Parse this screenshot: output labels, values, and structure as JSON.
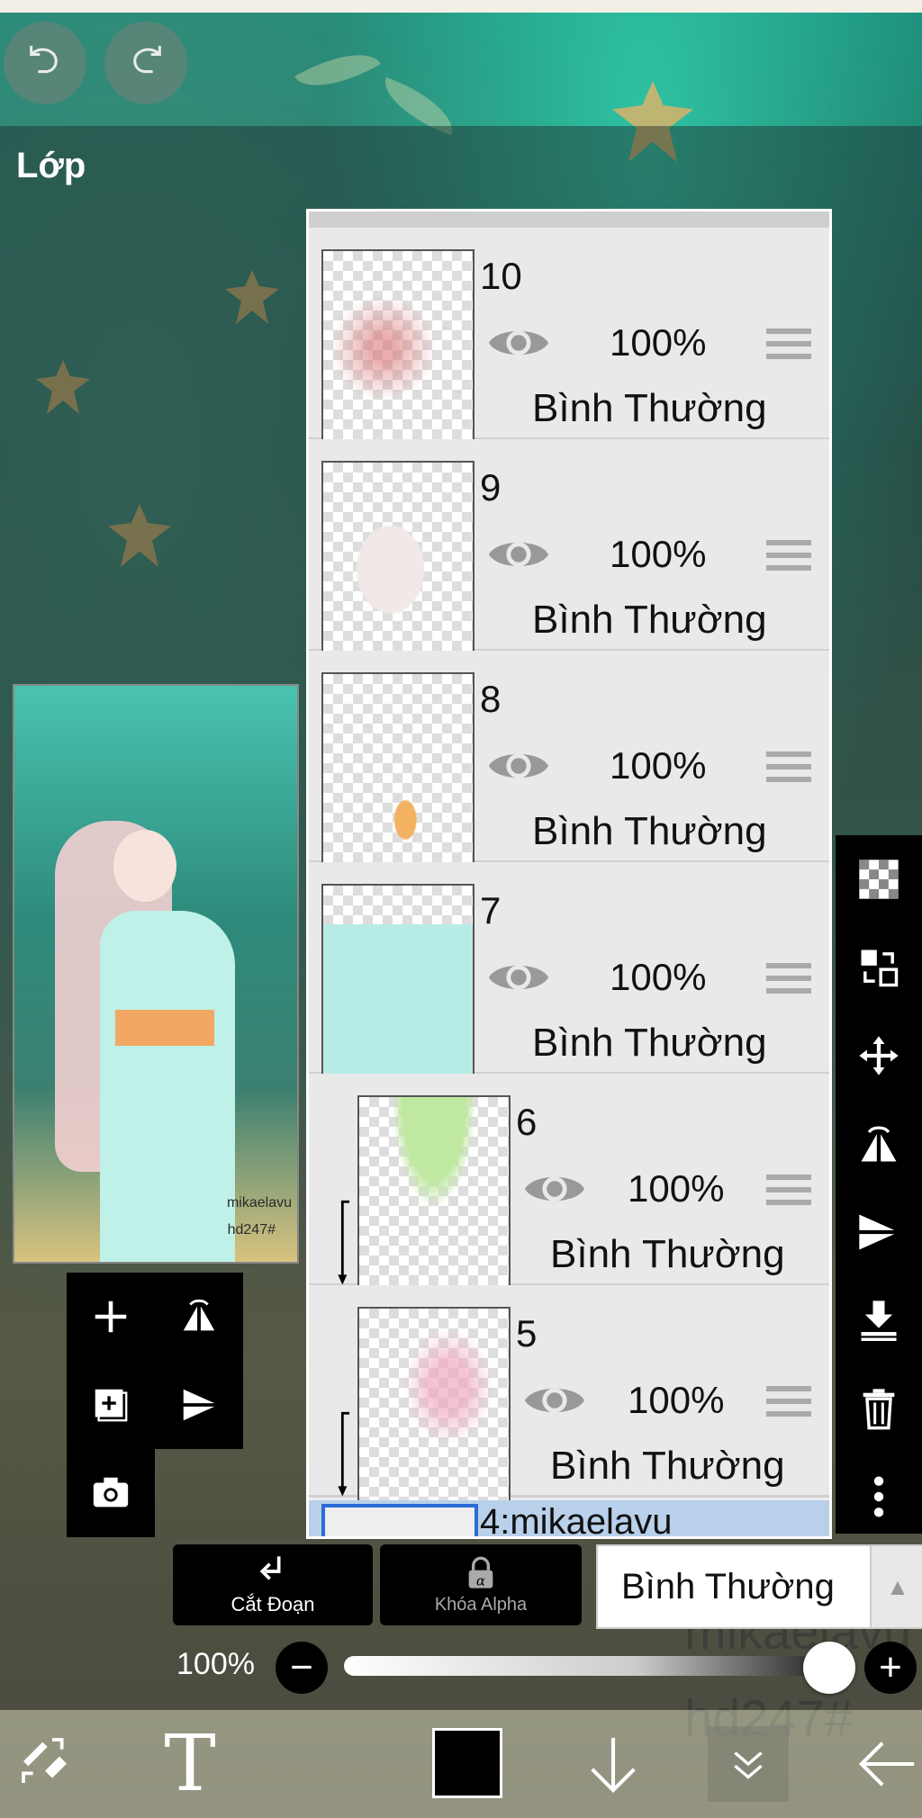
{
  "colors": {
    "panel_bg": "#ededed",
    "toolbar_bg": "#000000",
    "text": "#111111",
    "selected_row": "#b9d0ea",
    "current_color": "#000000"
  },
  "panel": {
    "title": "Lớp"
  },
  "preview": {
    "watermark_line1": "mikaelavu",
    "watermark_line2": "hd247#"
  },
  "layers": [
    {
      "number": "10",
      "opacity": "100%",
      "blend": "Bình Thường",
      "visible": true,
      "clipped": false
    },
    {
      "number": "9",
      "opacity": "100%",
      "blend": "Bình Thường",
      "visible": true,
      "clipped": false
    },
    {
      "number": "8",
      "opacity": "100%",
      "blend": "Bình Thường",
      "visible": true,
      "clipped": false
    },
    {
      "number": "7",
      "opacity": "100%",
      "blend": "Bình Thường",
      "visible": true,
      "clipped": false
    },
    {
      "number": "6",
      "opacity": "100%",
      "blend": "Bình Thường",
      "visible": true,
      "clipped": true
    },
    {
      "number": "5",
      "opacity": "100%",
      "blend": "Bình Thường",
      "visible": true,
      "clipped": true
    }
  ],
  "selected_layer_partial": "4:mikaelavu",
  "buttons": {
    "clip": "Cắt Đoạn",
    "alpha_lock": "Khóa Alpha"
  },
  "blend_mode": {
    "value": "Bình Thường"
  },
  "opacity": {
    "label": "100%",
    "value": 1.0
  },
  "canvas_ghost_text": {
    "line1": "mikaelavu",
    "line2": "hd247#"
  },
  "icons": {
    "undo": "undo-icon",
    "redo": "redo-icon",
    "add_layer": "plus-icon",
    "flip_h": "flip-horizontal-icon",
    "add_copy": "add-copy-icon",
    "flip_v": "flip-vertical-icon",
    "camera": "camera-icon",
    "transparent": "checker-icon",
    "swap": "swap-icon",
    "move": "move-icon",
    "merge_down": "merge-down-icon",
    "trash": "trash-icon",
    "more": "more-vertical-icon",
    "eye": "eye-icon",
    "handle": "drag-handle-icon",
    "brush": "brush-eraser-icon",
    "text": "text-tool-icon",
    "down_arrow": "arrow-down-icon",
    "layers_collapse": "double-chevron-down-icon",
    "back": "back-arrow-icon"
  }
}
